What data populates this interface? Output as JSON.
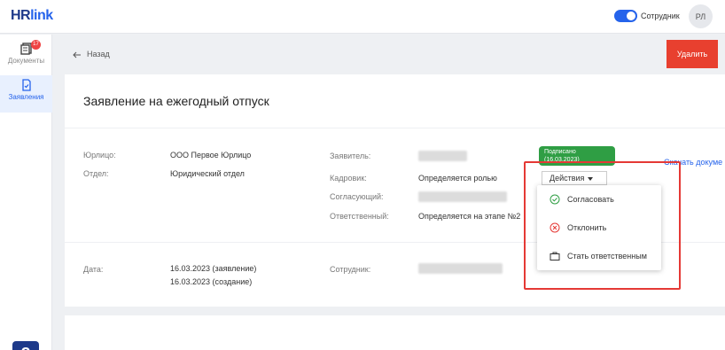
{
  "app": {
    "logo_main": "HR",
    "logo_accent": "link"
  },
  "header": {
    "role_label": "Сотрудник",
    "avatar_initials": "РЛ"
  },
  "sidebar": {
    "items": [
      {
        "label": "Документы",
        "badge": "17",
        "icon": "documents-icon"
      },
      {
        "label": "Заявления",
        "icon": "application-icon"
      }
    ],
    "help_label": "?"
  },
  "toolbar": {
    "back_label": "Назад",
    "delete_label": "Удалить"
  },
  "page": {
    "title": "Заявление на ежегодный отпуск"
  },
  "details": {
    "legal_entity_label": "Юрлицо:",
    "legal_entity_value": "ООО Первое Юрлицо",
    "department_label": "Отдел:",
    "department_value": "Юридический отдел",
    "applicant_label": "Заявитель:",
    "hr_label": "Кадровик:",
    "hr_value": "Определяется ролью",
    "approver_label": "Согласующий:",
    "responsible_label": "Ответственный:",
    "responsible_value": "Определяется на этапе №2",
    "status_line1": "Подписано",
    "status_line2": "(16.03.2023)",
    "download_label": "Скачать докуме"
  },
  "dates": {
    "date_label": "Дата:",
    "date_line1": "16.03.2023 (заявление)",
    "date_line2": "16.03.2023 (создание)",
    "employee_label": "Сотрудник:"
  },
  "actions": {
    "button_label": "Действия",
    "menu": [
      {
        "label": "Согласовать",
        "icon": "check-circle-icon",
        "color": "#2f9e44"
      },
      {
        "label": "Отклонить",
        "icon": "cross-circle-icon",
        "color": "#e53935"
      },
      {
        "label": "Стать ответственным",
        "icon": "briefcase-icon",
        "color": "#333333"
      }
    ]
  },
  "colors": {
    "accent": "#2563eb",
    "danger": "#e8402f",
    "success": "#2f9e44",
    "highlight": "#e53935"
  }
}
